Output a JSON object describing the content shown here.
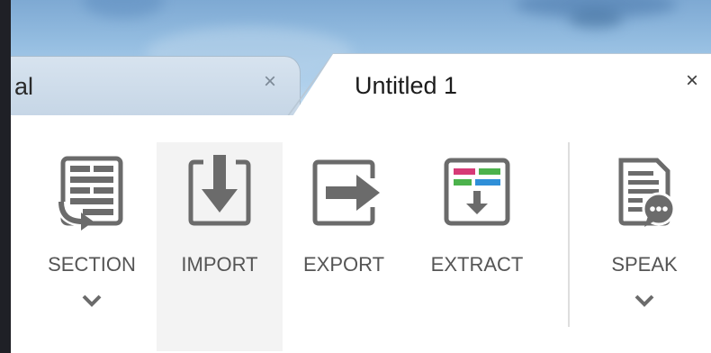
{
  "tabs": [
    {
      "label": "al",
      "close_glyph": "×",
      "active": false
    },
    {
      "label": "Untitled 1",
      "close_glyph": "×",
      "active": true
    }
  ],
  "ribbon": {
    "buttons": [
      {
        "label": "SECTION",
        "icon": "section-icon",
        "has_dropdown": true
      },
      {
        "label": "IMPORT",
        "icon": "import-icon",
        "has_dropdown": false
      },
      {
        "label": "EXPORT",
        "icon": "export-icon",
        "has_dropdown": false
      },
      {
        "label": "EXTRACT",
        "icon": "extract-icon",
        "has_dropdown": false
      },
      {
        "label": "SPEAK",
        "icon": "speak-icon",
        "has_dropdown": true
      }
    ]
  },
  "colors": {
    "icon_gray": "#6b6b6b",
    "extract_red": "#d63a76",
    "extract_green": "#4cb24c",
    "extract_blue": "#2f8fd8"
  }
}
